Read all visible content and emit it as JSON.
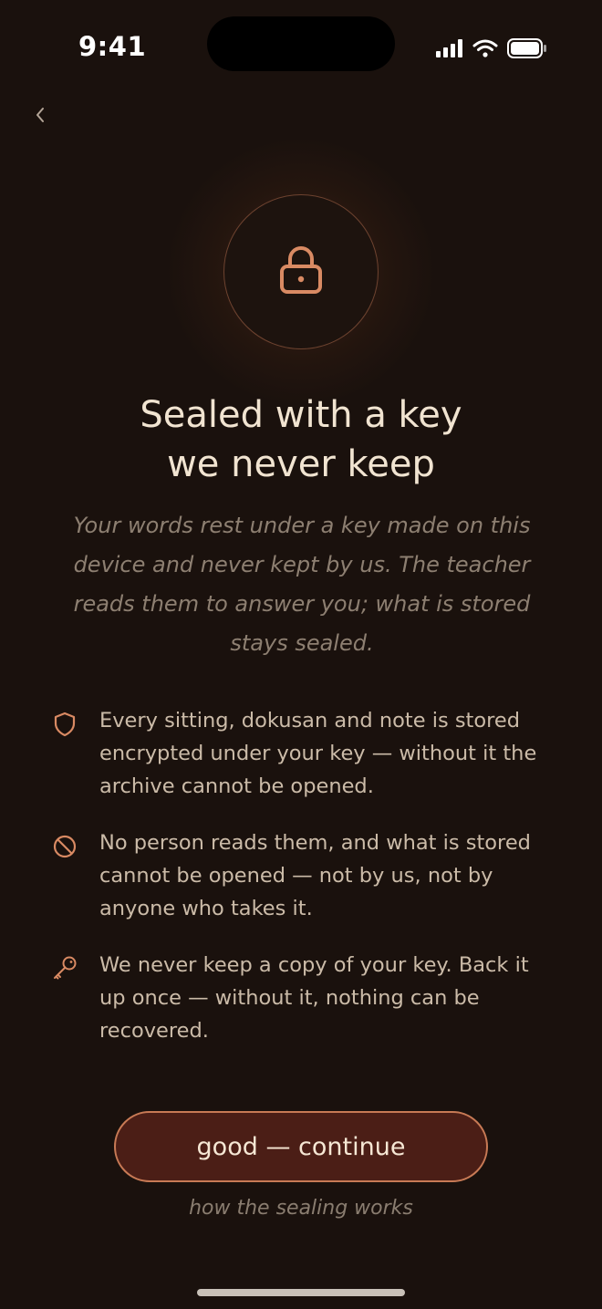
{
  "status_bar": {
    "time": "9:41",
    "icons": [
      "cellular-signal-icon",
      "wifi-icon",
      "battery-icon"
    ]
  },
  "nav": {
    "back_icon": "chevron-left-icon"
  },
  "hero": {
    "icon": "lock-icon",
    "title_line1": "Sealed with a key",
    "title_line2": "we never keep",
    "subtitle": "Your words rest under a key made on this device and never kept by us. The teacher reads them to answer you; what is stored stays sealed."
  },
  "features": [
    {
      "icon": "shield-icon",
      "text": "Every sitting, dokusan and note is stored encrypted under your key — without it the archive cannot be opened."
    },
    {
      "icon": "prohibited-icon",
      "text": "No person reads them, and what is stored cannot be opened — not by us, not by anyone who takes it."
    },
    {
      "icon": "key-icon",
      "text": "We never keep a copy of your key. Back it up once — without it, nothing can be recovered."
    }
  ],
  "actions": {
    "continue_label": "good — continue",
    "how_link_label": "how the sealing works"
  },
  "colors": {
    "background": "#1a110d",
    "accent": "#d98a63",
    "button_fill": "#4b1e16",
    "button_border": "#c87a55",
    "title_text": "#f1e4d1",
    "muted_text": "#8d7f71"
  }
}
